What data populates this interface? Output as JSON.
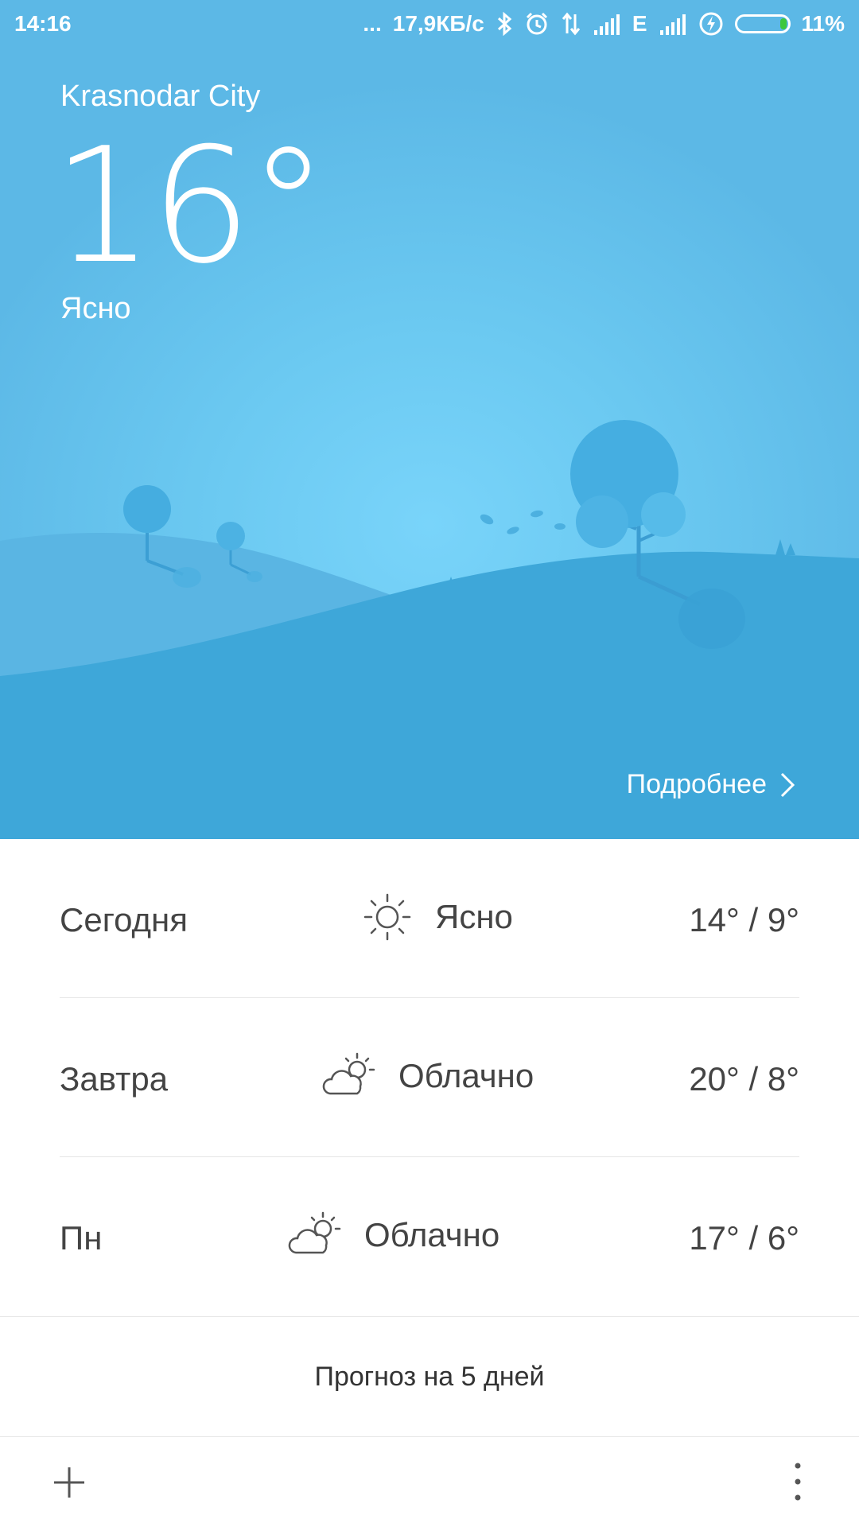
{
  "status_bar": {
    "time": "14:16",
    "more": "...",
    "network_speed": "17,9КБ/с",
    "network_type": "E",
    "battery_percent": "11%",
    "icons": [
      "bluetooth-icon",
      "alarm-icon",
      "data-transfer-icon",
      "signal-icon",
      "signal-icon",
      "charging-icon",
      "battery-icon"
    ]
  },
  "current": {
    "city": "Krasnodar City",
    "temperature": "16°",
    "condition": "Ясно",
    "details_label": "Подробнее"
  },
  "forecast": [
    {
      "day": "Сегодня",
      "icon": "sun-icon",
      "condition": "Ясно",
      "range": "14° / 9°"
    },
    {
      "day": "Завтра",
      "icon": "partly-cloudy-icon",
      "condition": "Облачно",
      "range": "20° / 8°"
    },
    {
      "day": "Пн",
      "icon": "partly-cloudy-icon",
      "condition": "Облачно",
      "range": "17° / 6°"
    }
  ],
  "five_day_label": "Прогноз на 5 дней",
  "bottom": {
    "add_icon": "plus-icon",
    "more_icon": "more-vertical-icon"
  },
  "colors": {
    "sky": "#6bc9f1",
    "hill_back": "#59b5e3",
    "hill_front": "#3fa8d9",
    "text_dark": "#444444",
    "battery_level": "#3ec73e"
  }
}
